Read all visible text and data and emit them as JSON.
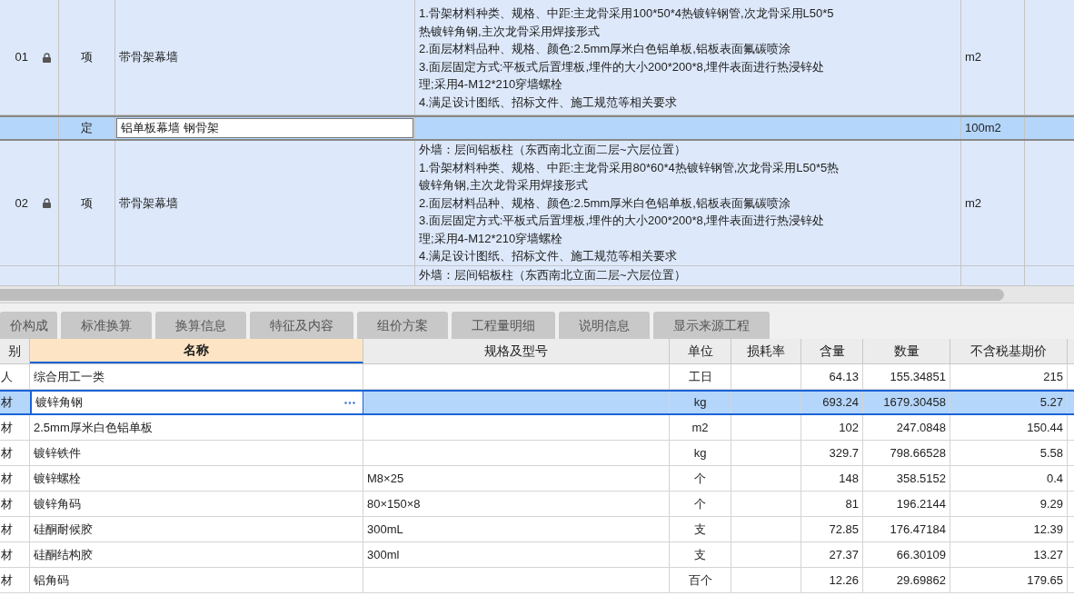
{
  "item_grid": {
    "rows": [
      {
        "code": "01",
        "locked": true,
        "type": "项",
        "name": "带骨架幕墙",
        "description": [
          "1.骨架材料种类、规格、中距:主龙骨采用100*50*4热镀锌钢管,次龙骨采用L50*5",
          "热镀锌角钢,主次龙骨采用焊接形式",
          "2.面层材料品种、规格、颜色:2.5mm厚米白色铝单板,铝板表面氟碳喷涂",
          "3.面层固定方式:平板式后置埋板,埋件的大小200*200*8,埋件表面进行热浸锌处",
          "理;采用4-M12*210穿墙螺栓",
          "4.满足设计图纸、招标文件、施工规范等相关要求"
        ],
        "unit": "m2",
        "selected": false,
        "editing": false
      },
      {
        "type": "定",
        "name": "铝单板幕墙 钢骨架",
        "locked": false,
        "unit": "100m2",
        "selected": true,
        "editing": true
      },
      {
        "code": "02",
        "locked": true,
        "type": "项",
        "name": "带骨架幕墙",
        "description": [
          "外墙：层间铝板柱（东西南北立面二层~六层位置）",
          "1.骨架材料种类、规格、中距:主龙骨采用80*60*4热镀锌钢管,次龙骨采用L50*5热",
          "镀锌角钢,主次龙骨采用焊接形式",
          "2.面层材料品种、规格、颜色:2.5mm厚米白色铝单板,铝板表面氟碳喷涂",
          "3.面层固定方式:平板式后置埋板,埋件的大小200*200*8,埋件表面进行热浸锌处",
          "理;采用4-M12*210穿墙螺栓",
          "4.满足设计图纸、招标文件、施工规范等相关要求"
        ],
        "unit": "m2",
        "selected": false,
        "editing": false
      },
      {
        "description": [
          "外墙：层间铝板柱（东西南北立面二层~六层位置）"
        ],
        "selected": false
      }
    ]
  },
  "tabs": [
    {
      "label": "价构成",
      "selected": false
    },
    {
      "label": "标准换算",
      "selected": false
    },
    {
      "label": "换算信息",
      "selected": false
    },
    {
      "label": "特征及内容",
      "selected": false
    },
    {
      "label": "组价方案",
      "selected": false
    },
    {
      "label": "工程量明细",
      "selected": false
    },
    {
      "label": "说明信息",
      "selected": false
    },
    {
      "label": "显示来源工程",
      "selected": false
    }
  ],
  "detail_table": {
    "columns": [
      {
        "label": "别",
        "highlighted": false
      },
      {
        "label": "名称",
        "highlighted": true
      },
      {
        "label": "规格及型号",
        "highlighted": false
      },
      {
        "label": "单位",
        "highlighted": false
      },
      {
        "label": "损耗率",
        "highlighted": false
      },
      {
        "label": "含量",
        "highlighted": false
      },
      {
        "label": "数量",
        "highlighted": false
      },
      {
        "label": "不含税基期价",
        "highlighted": false
      }
    ],
    "rows": [
      {
        "category": "人",
        "name": "综合用工一类",
        "unit": "工日",
        "content": "64.13",
        "quantity": "155.34851",
        "price": "215",
        "selected": false
      },
      {
        "category": "材",
        "name": "镀锌角钢",
        "unit": "kg",
        "content": "693.24",
        "quantity": "1679.30458",
        "price": "5.27",
        "selected": true
      },
      {
        "category": "材",
        "name": "2.5mm厚米白色铝单板",
        "unit": "m2",
        "content": "102",
        "quantity": "247.0848",
        "price": "150.44",
        "selected": false
      },
      {
        "category": "材",
        "name": "镀锌铁件",
        "unit": "kg",
        "content": "329.7",
        "quantity": "798.66528",
        "price": "5.58",
        "selected": false
      },
      {
        "category": "材",
        "name": "镀锌螺栓",
        "spec": "M8×25",
        "unit": "个",
        "content": "148",
        "quantity": "358.5152",
        "price": "0.4",
        "selected": false
      },
      {
        "category": "材",
        "name": "镀锌角码",
        "spec": "80×150×8",
        "unit": "个",
        "content": "81",
        "quantity": "196.2144",
        "price": "9.29",
        "selected": false
      },
      {
        "category": "材",
        "name": "硅酮耐候胶",
        "spec": "300mL",
        "unit": "支",
        "content": "72.85",
        "quantity": "176.47184",
        "price": "12.39",
        "selected": false
      },
      {
        "category": "材",
        "name": "硅酮结构胶",
        "spec": "300ml",
        "unit": "支",
        "content": "27.37",
        "quantity": "66.30109",
        "price": "13.27",
        "selected": false
      },
      {
        "category": "材",
        "name": "铝角码",
        "unit": "百个",
        "content": "12.26",
        "quantity": "29.69862",
        "price": "179.65",
        "selected": false
      }
    ]
  }
}
